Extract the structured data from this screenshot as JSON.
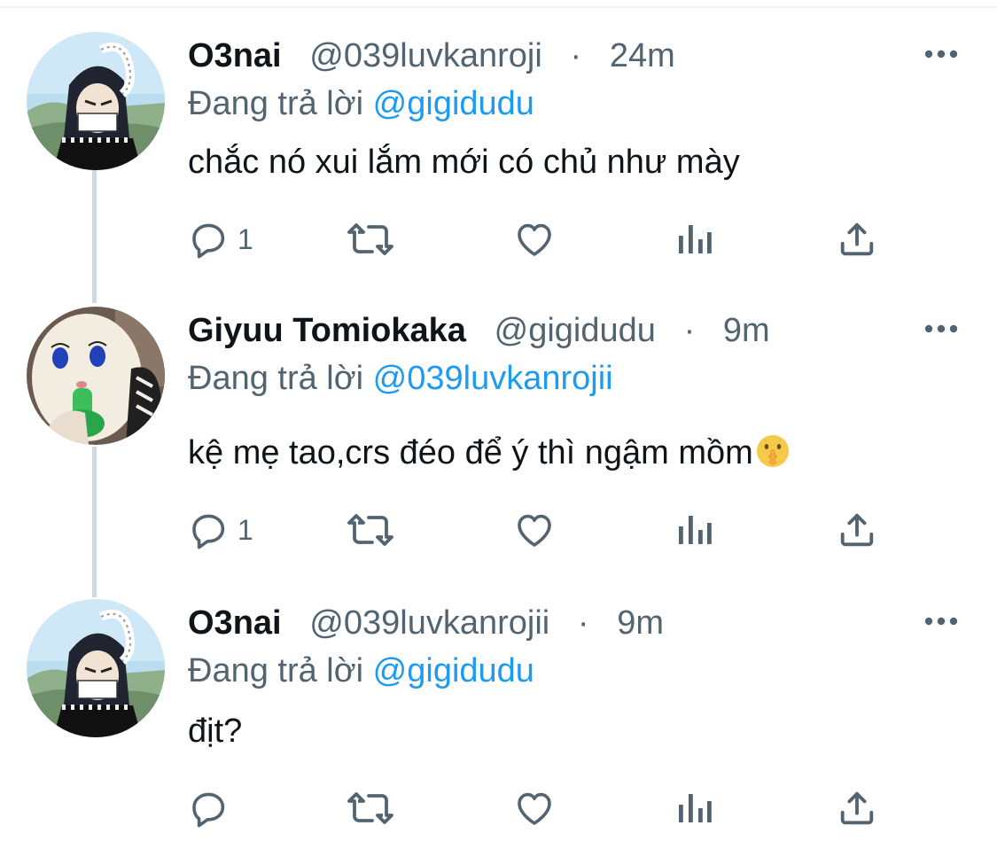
{
  "thread": {
    "tweets": [
      {
        "display_name": "O3nai",
        "handle": "@039luvkanroji",
        "separator": "·",
        "time": "24m",
        "reply_prefix": "Đang trả lời",
        "reply_to": "@gigidudu",
        "text": "chắc nó xui lắm mới có chủ như mày",
        "reply_count": "1",
        "avatar": "anime-character-avatar"
      },
      {
        "display_name": "Giyuu Tomiokaka",
        "handle": "@gigidudu",
        "separator": "·",
        "time": "9m",
        "reply_prefix": "Đang trả lời",
        "reply_to": "@039luvkanrojii",
        "text": "kệ mẹ tao,crs đéo để ý thì ngậm mồm",
        "text_emoji": "shushing-face-emoji",
        "reply_count": "1",
        "avatar": "plush-doll-avatar"
      },
      {
        "display_name": "O3nai",
        "handle": "@039luvkanrojii",
        "separator": "·",
        "time": "9m",
        "reply_prefix": "Đang trả lời",
        "reply_to": "@gigidudu",
        "text": "địt?",
        "reply_count": "",
        "avatar": "anime-character-avatar"
      }
    ]
  },
  "icons": {
    "more": "more-dots-icon",
    "reply": "reply-bubble-icon",
    "retweet": "retweet-icon",
    "like": "heart-icon",
    "views": "views-chart-icon",
    "share": "share-upload-icon"
  },
  "colors": {
    "text": "#0f1419",
    "secondary": "#536471",
    "link": "#1d9bf0",
    "thread_line": "#cfd9de",
    "divider": "#eff3f4"
  }
}
